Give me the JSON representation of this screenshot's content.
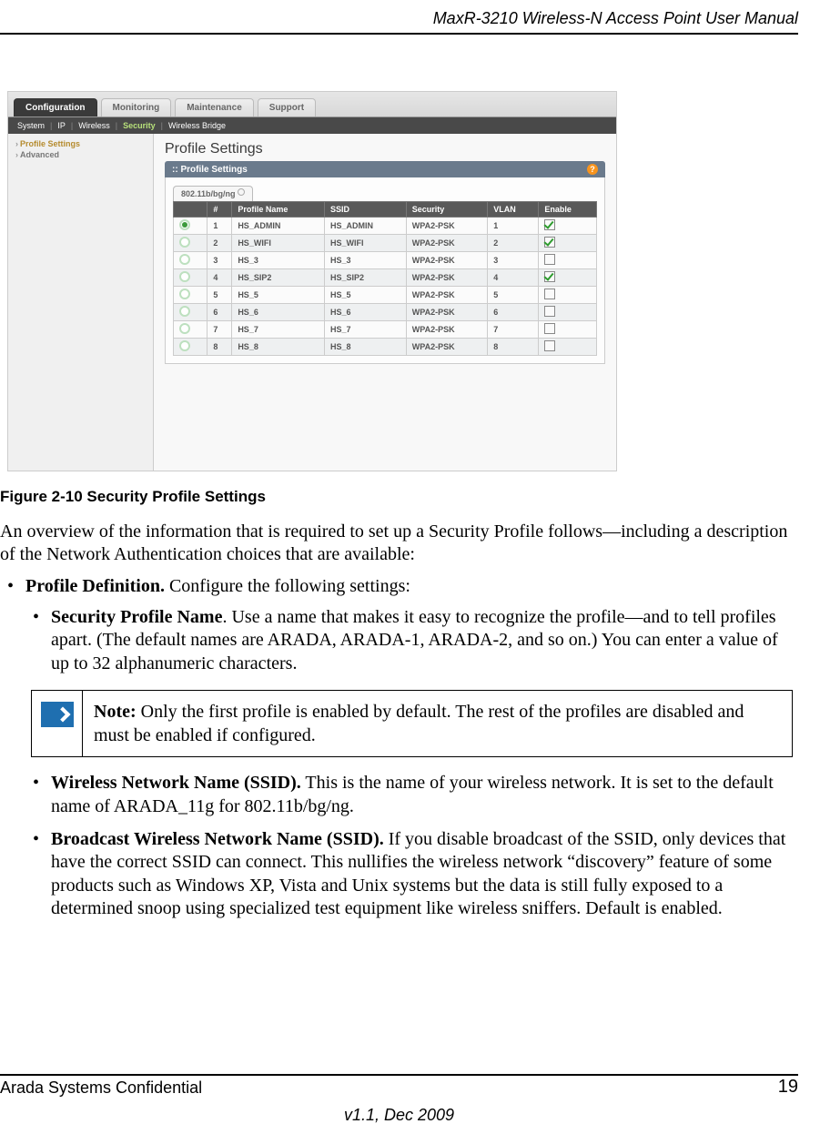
{
  "header": {
    "title": "MaxR-3210 Wireless-N Access Point User Manual"
  },
  "ui": {
    "tabs": [
      "Configuration",
      "Monitoring",
      "Maintenance",
      "Support"
    ],
    "subtabs": [
      "System",
      "IP",
      "Wireless",
      "Security",
      "Wireless Bridge"
    ],
    "sidebar": {
      "items": [
        "Profile Settings",
        "Advanced"
      ]
    },
    "page_title": "Profile Settings",
    "panel_title": "Profile Settings",
    "mode_tab": "802.11b/bg/ng",
    "columns": [
      "",
      "#",
      "Profile Name",
      "SSID",
      "Security",
      "VLAN",
      "Enable"
    ],
    "rows": [
      {
        "sel": true,
        "n": "1",
        "name": "HS_ADMIN",
        "ssid": "HS_ADMIN",
        "sec": "WPA2-PSK",
        "vlan": "1",
        "en": true
      },
      {
        "sel": false,
        "n": "2",
        "name": "HS_WIFI",
        "ssid": "HS_WIFI",
        "sec": "WPA2-PSK",
        "vlan": "2",
        "en": true
      },
      {
        "sel": false,
        "n": "3",
        "name": "HS_3",
        "ssid": "HS_3",
        "sec": "WPA2-PSK",
        "vlan": "3",
        "en": false
      },
      {
        "sel": false,
        "n": "4",
        "name": "HS_SIP2",
        "ssid": "HS_SIP2",
        "sec": "WPA2-PSK",
        "vlan": "4",
        "en": true
      },
      {
        "sel": false,
        "n": "5",
        "name": "HS_5",
        "ssid": "HS_5",
        "sec": "WPA2-PSK",
        "vlan": "5",
        "en": false
      },
      {
        "sel": false,
        "n": "6",
        "name": "HS_6",
        "ssid": "HS_6",
        "sec": "WPA2-PSK",
        "vlan": "6",
        "en": false
      },
      {
        "sel": false,
        "n": "7",
        "name": "HS_7",
        "ssid": "HS_7",
        "sec": "WPA2-PSK",
        "vlan": "7",
        "en": false
      },
      {
        "sel": false,
        "n": "8",
        "name": "HS_8",
        "ssid": "HS_8",
        "sec": "WPA2-PSK",
        "vlan": "8",
        "en": false
      }
    ]
  },
  "doc": {
    "figure_caption": "Figure 2-10  Security Profile Settings",
    "para1": "An overview of the information that is required to set up a Security Profile follows—including a description of the Network Authentication choices that are available:",
    "b1_label": "Profile Definition.",
    "b1_tail": " Configure the following settings:",
    "s1_label": "Security Profile Name",
    "s1_tail": ". Use a name that makes it easy to recognize the profile—and to tell profiles apart. (The default names are ARADA, ARADA-1, ARADA-2, and so on.) You can enter a value of up to 32 alphanumeric characters.",
    "note_label": "Note:",
    "note_tail": " Only the first profile is enabled by default. The rest of the profiles are disabled and must be enabled if configured.",
    "s2_label": "Wireless Network Name (SSID).",
    "s2_tail": " This is the name of your wireless network. It is set to the default name of ARADA_11g for 802.11b/bg/ng.",
    "s3_label": "Broadcast Wireless Network Name (SSID).",
    "s3_tail": " If you disable broadcast of the SSID, only devices that have the correct SSID can connect. This nullifies the wireless network “discovery” feature of some products such as Windows XP, Vista and Unix systems but the data is still fully exposed to a determined snoop using specialized test equipment like wireless sniffers. Default is enabled."
  },
  "footer": {
    "left": "Arada Systems Confidential",
    "right": "19",
    "version": "v1.1, Dec 2009"
  }
}
